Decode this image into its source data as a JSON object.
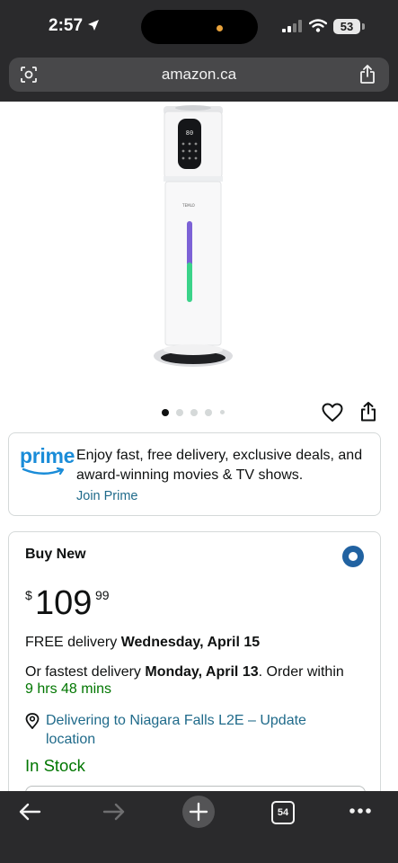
{
  "status_bar": {
    "time": "2:57",
    "battery": "53",
    "location_icon": "location-arrow-icon",
    "signal_icon": "cellular-signal-icon",
    "wifi_icon": "wifi-icon"
  },
  "browser": {
    "url": "amazon.ca",
    "left_icon": "page-scan-icon",
    "right_icon": "share-icon"
  },
  "product": {
    "image_icon": "humidifier-product-image",
    "image_brand_text": "TEMLO",
    "carousel_total": 5,
    "carousel_active": 1,
    "wishlist_icon": "heart-icon",
    "share_icon": "share-icon"
  },
  "prime": {
    "logo": "prime",
    "text": "Enjoy fast, free delivery, exclusive deals, and award-winning movies & TV shows.",
    "link": "Join Prime"
  },
  "buy_box": {
    "title": "Buy New",
    "price_symbol": "$",
    "price_whole": "109",
    "price_fraction": "99",
    "free_delivery_prefix": "FREE delivery ",
    "free_delivery_date": "Wednesday, April 15",
    "fastest_prefix": "Or fastest delivery ",
    "fastest_date": "Monday, April 13",
    "fastest_suffix": ". Order within",
    "order_within": "9 hrs 48 mins",
    "deliver_to": "Delivering to Niagara Falls L2E – Update location",
    "stock": "In Stock"
  },
  "toolbar": {
    "back_icon": "back-arrow-icon",
    "forward_icon": "forward-arrow-icon",
    "new_tab_icon": "plus-icon",
    "tabs_count": "54",
    "more_icon": "more-dots-icon"
  },
  "colors": {
    "chrome_bg": "#2a2a2c",
    "link": "#1f6a8a",
    "prime_blue": "#1a8cd8",
    "in_stock_green": "#007600",
    "radio_blue": "#2162a1"
  }
}
